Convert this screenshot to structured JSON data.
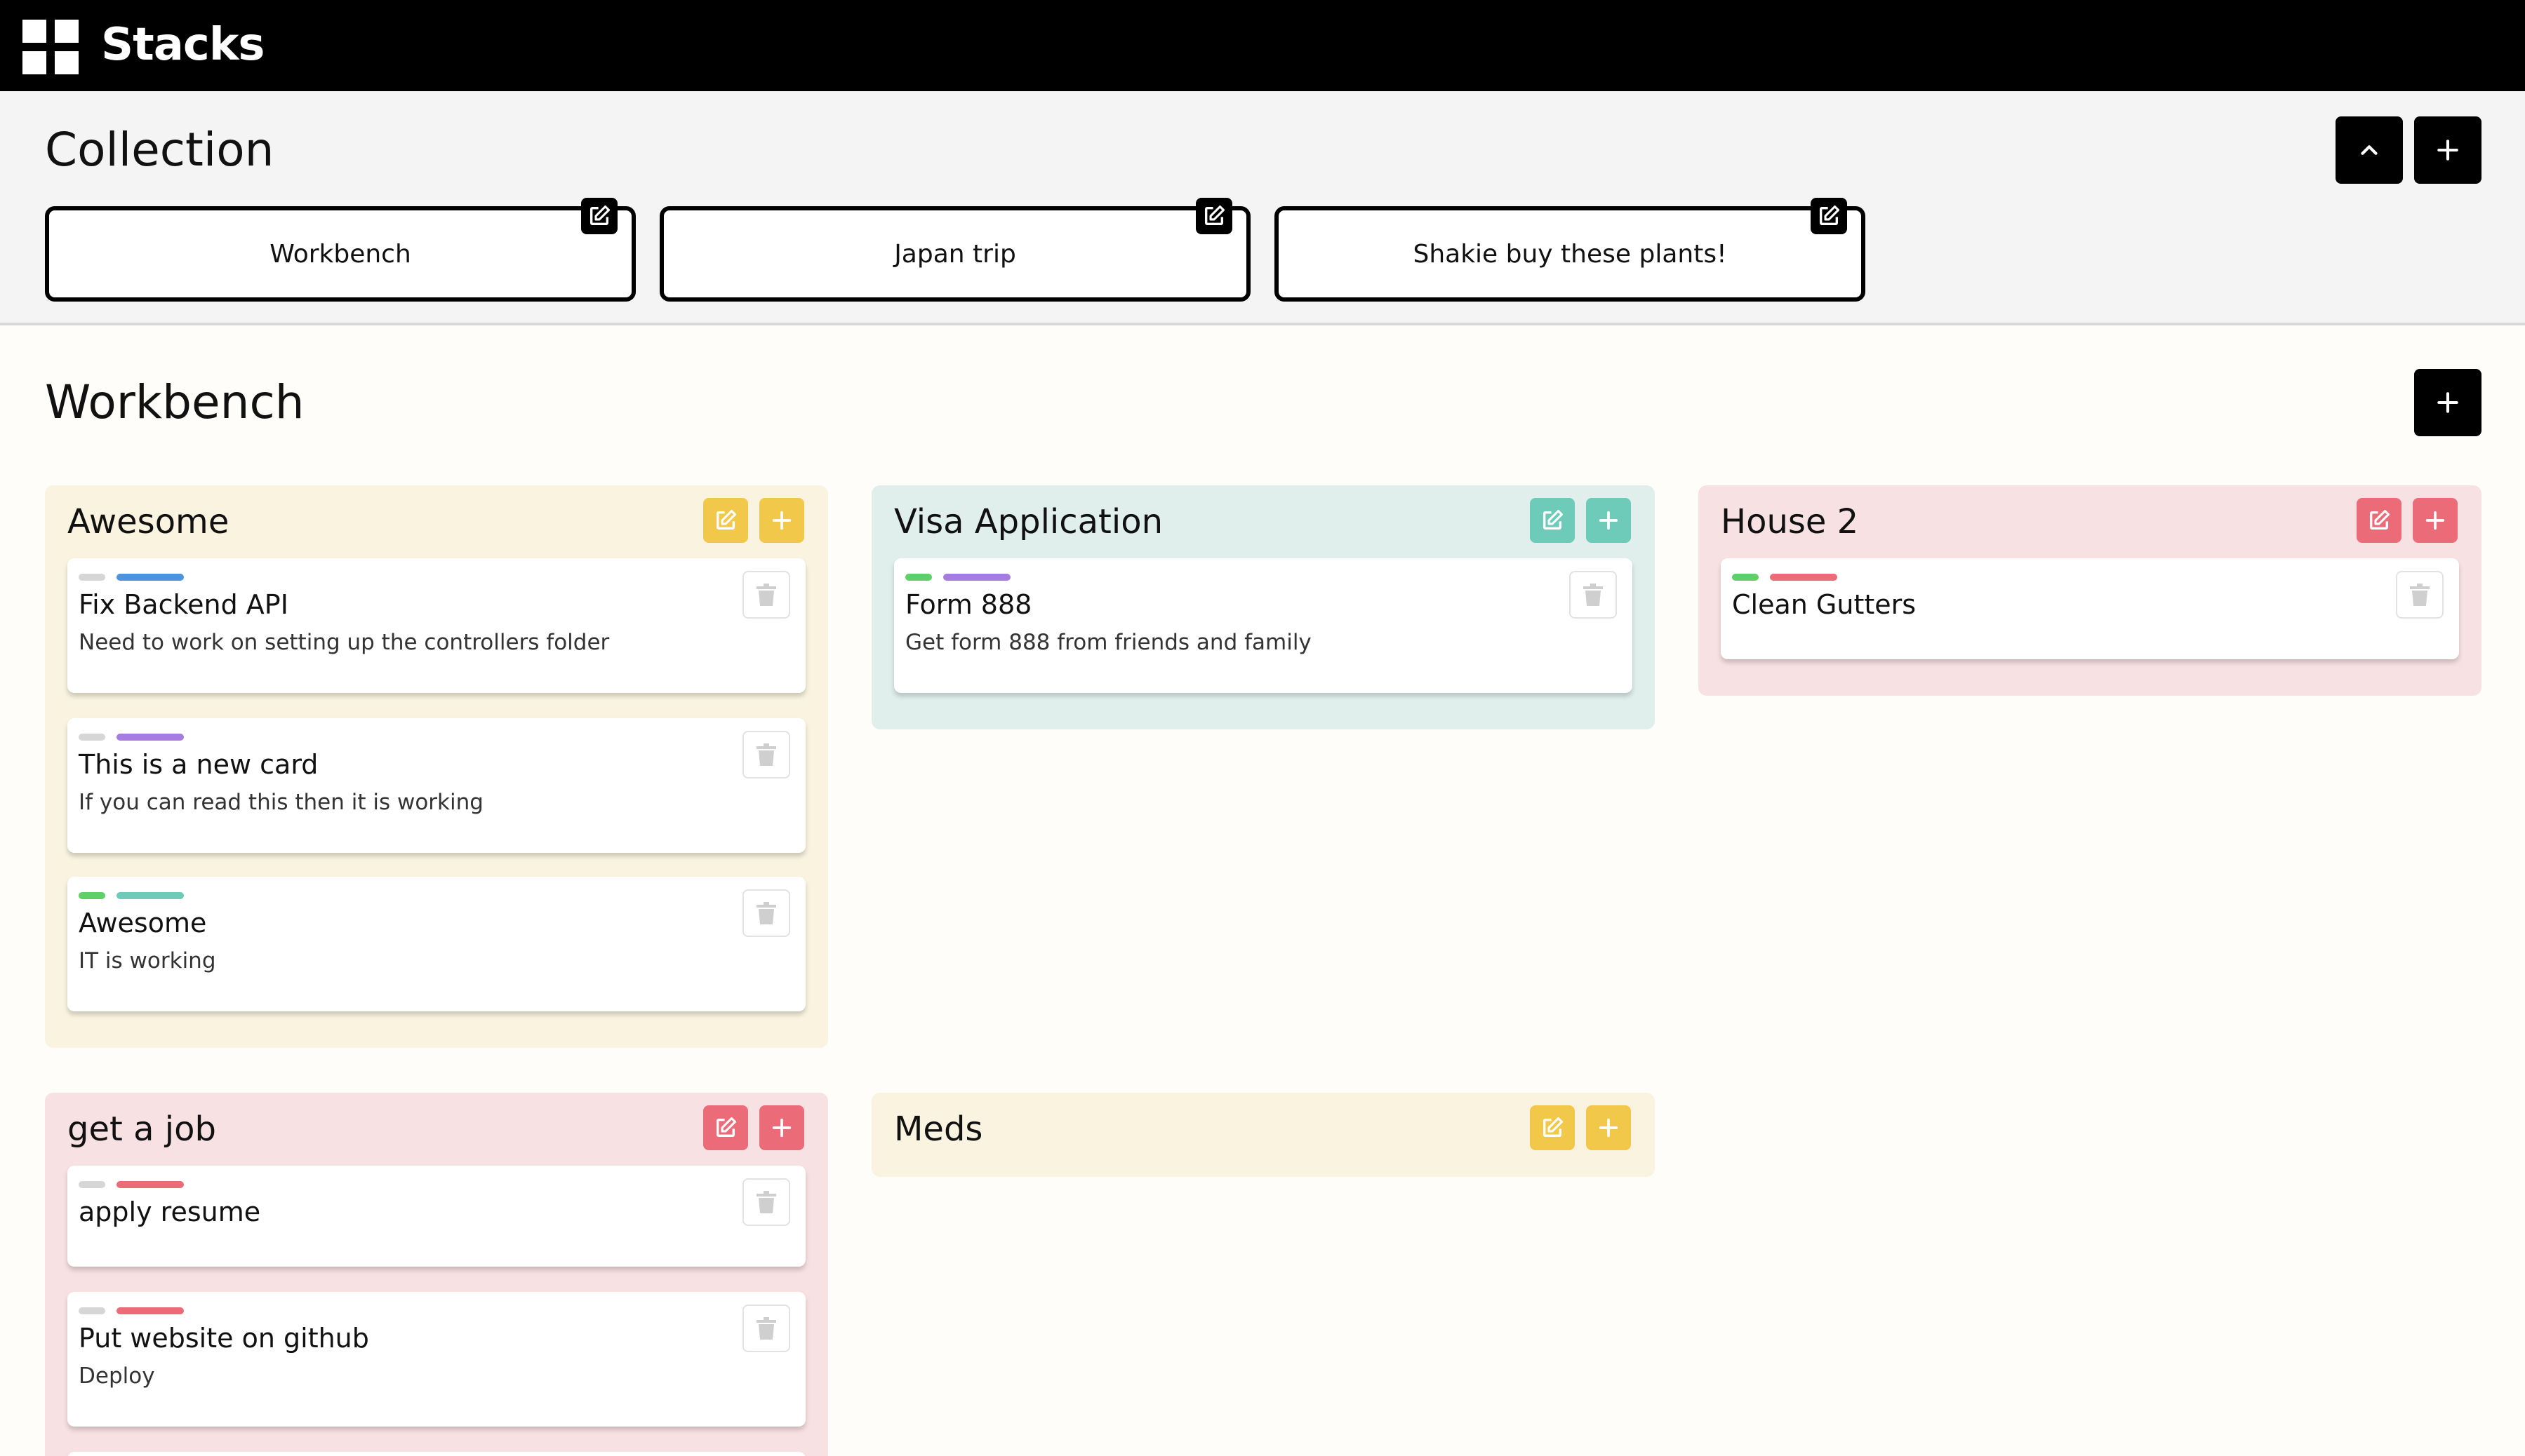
{
  "app": {
    "title": "Stacks",
    "logo_icon": "grid-logo-icon"
  },
  "collection": {
    "heading": "Collection",
    "buttons": {
      "collapse_icon": "chevron-up-icon",
      "add_icon": "plus-icon"
    },
    "boards": [
      {
        "label": "Workbench",
        "edit_icon": "edit-icon"
      },
      {
        "label": "Japan trip",
        "edit_icon": "edit-icon"
      },
      {
        "label": "Shakie buy these plants!",
        "edit_icon": "edit-icon"
      }
    ]
  },
  "board": {
    "title": "Workbench",
    "add_icon": "plus-icon",
    "stacks": [
      {
        "title": "Awesome",
        "theme": "yellow",
        "cards": [
          {
            "title": "Fix Backend API",
            "description": "Need to work on setting up the controllers folder"
          },
          {
            "title": "This is a new card",
            "description": "If you can read this then it is working"
          },
          {
            "title": "Awesome",
            "description": "IT is working"
          }
        ]
      },
      {
        "title": "Visa Application",
        "theme": "teal",
        "cards": [
          {
            "title": "Form 888",
            "description": "Get form 888 from friends and family"
          }
        ]
      },
      {
        "title": "House 2",
        "theme": "red",
        "cards": [
          {
            "title": "Clean Gutters",
            "description": ""
          }
        ]
      },
      {
        "title": "get a job",
        "theme": "red",
        "cards": [
          {
            "title": "apply resume",
            "description": ""
          },
          {
            "title": "Put website on github",
            "description": "Deploy"
          }
        ]
      },
      {
        "title": "Meds",
        "theme": "yellow",
        "cards": []
      }
    ]
  },
  "colors": {
    "yellow_bg": "#f9f3df",
    "yellow_btn": "#f2c84b",
    "teal_bg": "#e0efec",
    "teal_btn": "#6ecab9",
    "red_bg": "#f8e1e3",
    "red_btn": "#eb6b78",
    "tag_gray": "#d6d6d6",
    "tag_green": "#5fd068",
    "tag_blue": "#4c94dd",
    "tag_purple": "#a67ce0",
    "tag_teal": "#6ecab9",
    "tag_red": "#eb6b78"
  }
}
